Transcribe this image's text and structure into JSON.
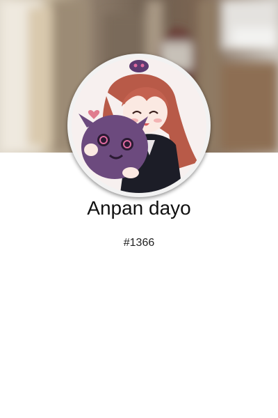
{
  "profile": {
    "username": "Anpan dayo",
    "discriminator": "#1366",
    "banner_image": "blurred-room-photo",
    "avatar_image": "anime-girl-hugging-purple-creature"
  },
  "colors": {
    "background": "#ffffff",
    "avatar_ring": "#f2f2f2",
    "text": "#111111"
  }
}
